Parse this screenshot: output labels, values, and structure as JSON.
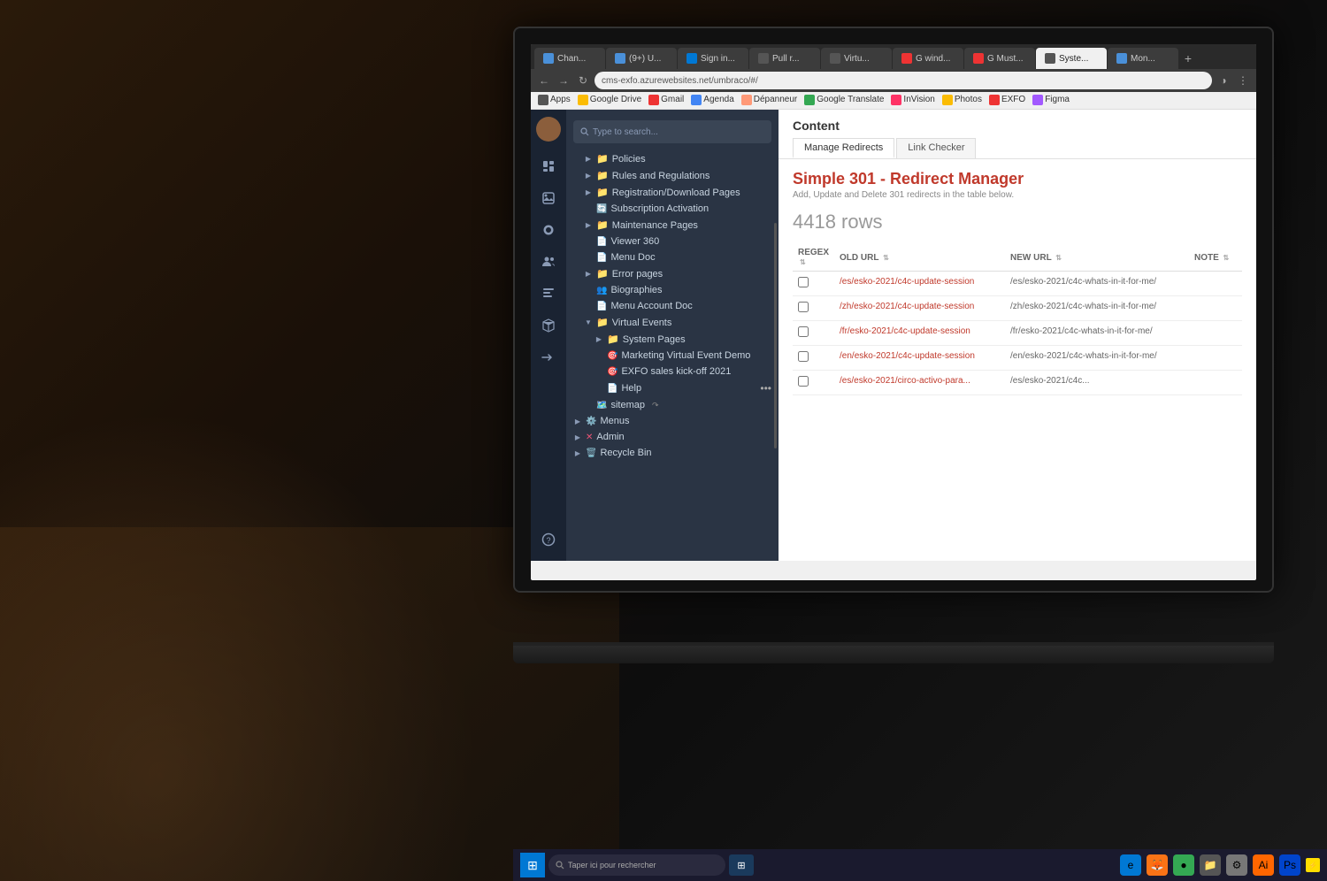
{
  "browser": {
    "address": "cms-exfo.azurewebsites.net/umbraco/#/",
    "tabs": [
      {
        "label": "Chan...",
        "active": false,
        "favicon": "blue"
      },
      {
        "label": "(9+) U...",
        "active": false,
        "favicon": "blue"
      },
      {
        "label": "Sign in...",
        "active": false,
        "favicon": "ms-blue"
      },
      {
        "label": "Pull r...",
        "active": false,
        "favicon": "gray"
      },
      {
        "label": "Virtu...",
        "active": false,
        "favicon": "gray"
      },
      {
        "label": "G wind...",
        "active": false,
        "favicon": "google"
      },
      {
        "label": "G Must...",
        "active": false,
        "favicon": "google"
      },
      {
        "label": "Syste...",
        "active": false,
        "favicon": "ms-blue"
      },
      {
        "label": "Mon...",
        "active": true,
        "favicon": "blue"
      }
    ],
    "bookmarks": [
      "Apps",
      "Google Drive",
      "Gmail",
      "Agenda",
      "Dépanneur",
      "Google Translate",
      "InVision",
      "Photos",
      "EXFO",
      "Figma"
    ]
  },
  "cms": {
    "search_placeholder": "Type to search...",
    "sidebar_icons": [
      "content",
      "media",
      "settings",
      "users",
      "forms",
      "packages",
      "redirect",
      "help"
    ],
    "tree_items": [
      {
        "label": "Policies",
        "level": 1,
        "type": "folder",
        "arrow": true
      },
      {
        "label": "Rules and Regulations",
        "level": 1,
        "type": "folder",
        "arrow": true
      },
      {
        "label": "Registration/Download Pages",
        "level": 1,
        "type": "folder",
        "arrow": true
      },
      {
        "label": "Subscription Activation",
        "level": 1,
        "type": "page",
        "arrow": false
      },
      {
        "label": "Maintenance Pages",
        "level": 1,
        "type": "folder",
        "arrow": true
      },
      {
        "label": "Viewer 360",
        "level": 1,
        "type": "page",
        "arrow": false
      },
      {
        "label": "Menu Doc",
        "level": 1,
        "type": "page",
        "arrow": false
      },
      {
        "label": "Error pages",
        "level": 1,
        "type": "folder",
        "arrow": true
      },
      {
        "label": "Biographies",
        "level": 1,
        "type": "people",
        "arrow": false
      },
      {
        "label": "Menu Account Doc",
        "level": 1,
        "type": "page",
        "arrow": false
      },
      {
        "label": "Virtual Events",
        "level": 1,
        "type": "folder",
        "arrow": true
      },
      {
        "label": "System Pages",
        "level": 2,
        "type": "folder",
        "arrow": true
      },
      {
        "label": "Marketing Virtual Event Demo",
        "level": 2,
        "type": "event",
        "arrow": false
      },
      {
        "label": "EXFO sales kick-off 2021",
        "level": 2,
        "type": "event",
        "arrow": false
      },
      {
        "label": "Help",
        "level": 2,
        "type": "page",
        "arrow": false
      },
      {
        "label": "sitemap",
        "level": 1,
        "type": "sitemap",
        "arrow": false
      },
      {
        "label": "Menus",
        "level": 0,
        "type": "folder",
        "arrow": true
      },
      {
        "label": "Admin",
        "level": 0,
        "type": "folder",
        "arrow": true
      },
      {
        "label": "Recycle Bin",
        "level": 0,
        "type": "bin",
        "arrow": true
      }
    ]
  },
  "content": {
    "title": "Content",
    "tabs": [
      {
        "label": "Manage Redirects",
        "active": true
      },
      {
        "label": "Link Checker",
        "active": false
      }
    ],
    "redirect_manager": {
      "title": "Simple 301 - Redirect Manager",
      "subtitle": "Add, Update and Delete 301 redirects in the table below.",
      "rows_count": "4418 rows",
      "table_headers": [
        "REGEX",
        "OLD URL",
        "NEW URL",
        "NOTE"
      ],
      "rows": [
        {
          "regex": false,
          "old_url": "/es/esko-2021/c4c-update-session",
          "new_url": "/es/esko-2021/c4c-whats-in-it-for-me/",
          "note": ""
        },
        {
          "regex": false,
          "old_url": "/zh/esko-2021/c4c-update-session",
          "new_url": "/zh/esko-2021/c4c-whats-in-it-for-me/",
          "note": ""
        },
        {
          "regex": false,
          "old_url": "/fr/esko-2021/c4c-update-session",
          "new_url": "/fr/esko-2021/c4c-whats-in-it-for-me/",
          "note": ""
        },
        {
          "regex": false,
          "old_url": "/en/esko-2021/c4c-update-session",
          "new_url": "/en/esko-2021/c4c-whats-in-it-for-me/",
          "note": ""
        },
        {
          "regex": false,
          "old_url": "/es/esko-2021/circo-activo-para...",
          "new_url": "/es/esko-2021/c4c...",
          "note": ""
        }
      ]
    }
  },
  "taskbar": {
    "search_text": "Taper ici pour rechercher",
    "apps": [
      "⊞",
      "🔍",
      "⬡",
      "🦊",
      "●",
      "🎵",
      "📁",
      "Ai",
      "Ps",
      "⚡"
    ]
  }
}
